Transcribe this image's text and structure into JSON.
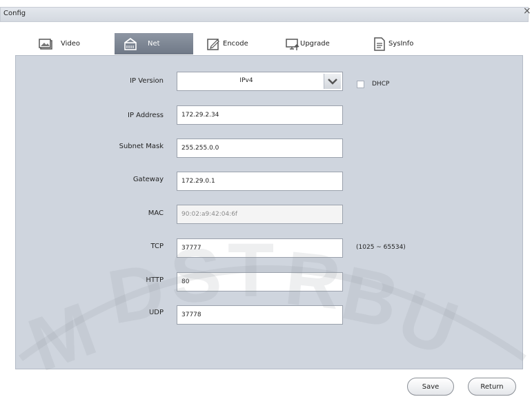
{
  "window": {
    "title": "Config",
    "close_glyph": "×"
  },
  "tabs": [
    {
      "label": "Video",
      "icon": "image-icon"
    },
    {
      "label": "Net",
      "icon": "network-icon"
    },
    {
      "label": "Encode",
      "icon": "edit-icon"
    },
    {
      "label": "Upgrade",
      "icon": "monitor-upgrade-icon"
    },
    {
      "label": "SysInfo",
      "icon": "document-icon"
    }
  ],
  "active_tab": "Net",
  "form": {
    "ip_version": {
      "label": "IP Version",
      "value": "IPv4"
    },
    "dhcp": {
      "label": "DHCP",
      "checked": false
    },
    "ip_address": {
      "label": "IP Address",
      "value": "172.29.2.34"
    },
    "subnet_mask": {
      "label": "Subnet Mask",
      "value": "255.255.0.0"
    },
    "gateway": {
      "label": "Gateway",
      "value": "172.29.0.1"
    },
    "mac": {
      "label": "MAC",
      "value": "90:02:a9:42:04:6f"
    },
    "tcp": {
      "label": "TCP",
      "value": "37777",
      "range": "(1025 ~ 65534)"
    },
    "http": {
      "label": "HTTP",
      "value": "80"
    },
    "udp": {
      "label": "UDP",
      "value": "37778"
    }
  },
  "buttons": {
    "save": "Save",
    "return": "Return"
  },
  "colors": {
    "panel_bg": "#cfd5de",
    "active_tab": "#7a8391",
    "titlebar": "#dde1e7"
  }
}
